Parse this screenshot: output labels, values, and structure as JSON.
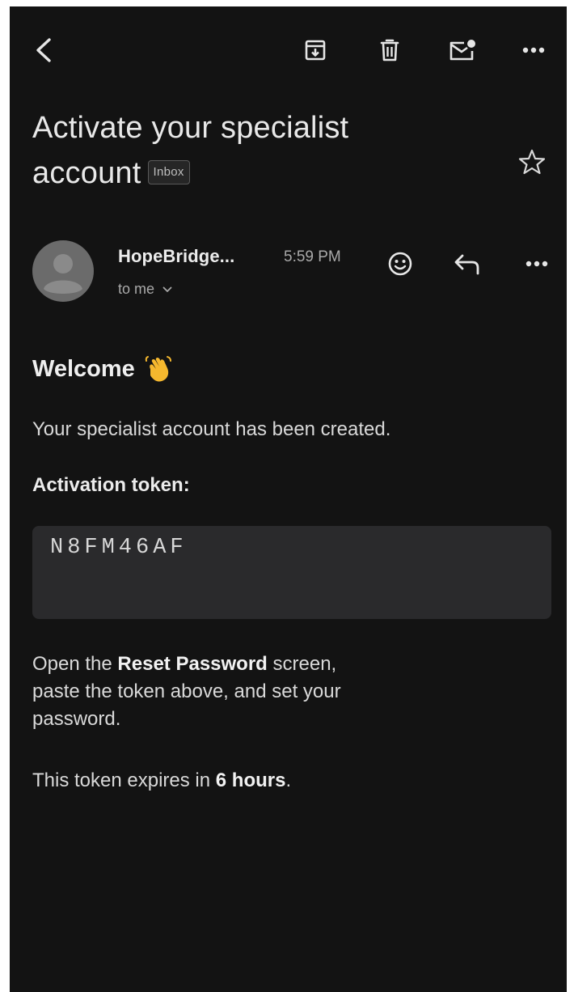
{
  "toolbar": {
    "icons": [
      "back-arrow-icon",
      "archive-icon",
      "trash-icon",
      "mark-unread-icon",
      "more-horizontal-icon"
    ]
  },
  "email": {
    "subject_line1": "Activate your specialist",
    "subject_line2": "account",
    "label": "Inbox",
    "sender": "HopeBridge...",
    "time": "5:59 PM",
    "recipient": "to me",
    "body": {
      "greeting": "Welcome",
      "greeting_emoji": "👋",
      "intro": "Your specialist account has been created.",
      "token_label": "Activation token:",
      "token": "N8FM46AF",
      "instr_pre": "Open the ",
      "instr_bold": "Reset Password",
      "instr_line1_post": " screen,",
      "instr_line2": "paste the token above, and set your",
      "instr_line3": "password.",
      "expiry_pre": "This token expires in ",
      "expiry_bold": "6 hours",
      "expiry_post": "."
    }
  },
  "colors": {
    "background": "#131313",
    "text": "#e3e3e3",
    "muted": "#a9a9a9",
    "token_box": "#2a2a2c",
    "emoji_hand": "#f5b82e"
  }
}
